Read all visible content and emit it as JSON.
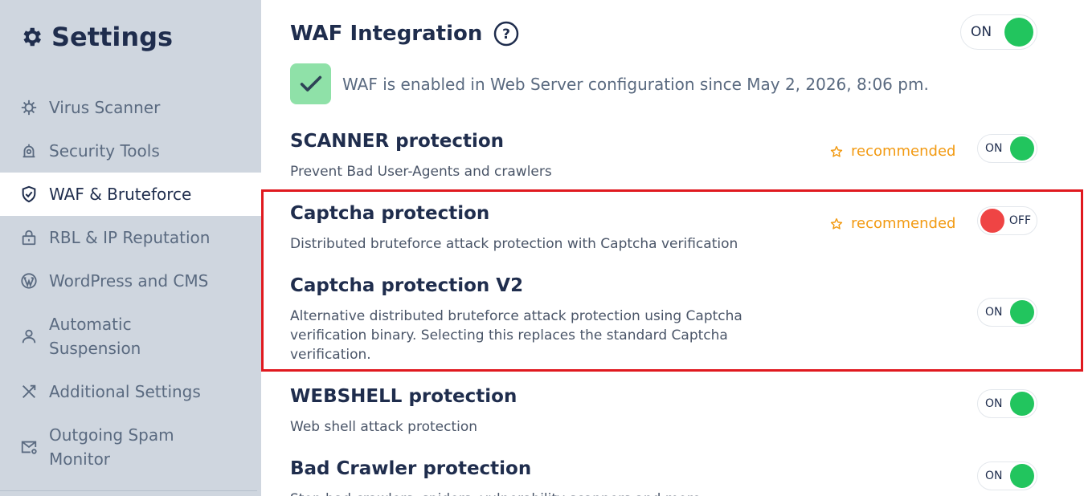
{
  "sidebar": {
    "title": "Settings",
    "title_icon": "gear-icon",
    "items": [
      {
        "label": "Virus Scanner",
        "icon": "virus-icon",
        "active": false
      },
      {
        "label": "Security Tools",
        "icon": "security-tools-icon",
        "active": false
      },
      {
        "label": "WAF & Bruteforce",
        "icon": "shield-check-icon",
        "active": true
      },
      {
        "label": "RBL & IP Reputation",
        "icon": "lock-icon",
        "active": false
      },
      {
        "label": "WordPress and CMS",
        "icon": "wordpress-icon",
        "active": false
      },
      {
        "label": "Automatic Suspension",
        "icon": "user-icon",
        "active": false
      },
      {
        "label": "Additional Settings",
        "icon": "tools-icon",
        "active": false
      },
      {
        "label": "Outgoing Spam Monitor",
        "icon": "mail-gear-icon",
        "active": false
      }
    ]
  },
  "waf": {
    "title": "WAF Integration",
    "toggle": "ON",
    "status_text": "WAF is enabled in Web Server configuration since May 2, 2026, 8:06 pm."
  },
  "recommended_label": "recommended",
  "sections": [
    {
      "title": "SCANNER protection",
      "description": "Prevent Bad User-Agents and crawlers",
      "toggle": "ON",
      "recommended": true
    },
    {
      "title": "Captcha protection",
      "description": "Distributed bruteforce attack protection with Captcha verification",
      "toggle": "OFF",
      "recommended": true
    },
    {
      "title": "Captcha protection V2",
      "description_lines": [
        "Alternative distributed bruteforce attack protection using Captcha",
        "verification binary. Selecting this replaces the standard Captcha",
        "verification."
      ],
      "toggle": "ON",
      "recommended": false
    },
    {
      "title": "WEBSHELL protection",
      "description": "Web shell attack protection",
      "toggle": "ON",
      "recommended": false
    },
    {
      "title": "Bad Crawler protection",
      "description": "Stop bad crawlers, spiders, vulnerability scanners and more",
      "toggle": "ON",
      "recommended": false
    }
  ],
  "colors": {
    "sidebar_bg": "#cfd6df",
    "accent_on": "#22c55e",
    "accent_off": "#ef4444",
    "recommended": "#f29a12",
    "highlight": "#e0191f"
  }
}
